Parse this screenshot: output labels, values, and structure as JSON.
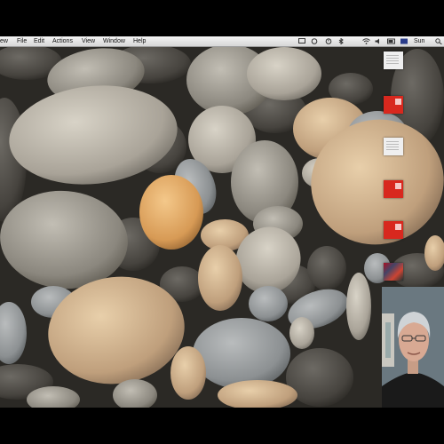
{
  "menubar": {
    "app_menu_partial": "ew",
    "items": [
      "File",
      "Edit",
      "Actions",
      "View",
      "Window",
      "Help"
    ],
    "right_label": "Sun"
  },
  "desktop": {
    "background": "river-stones-wallpaper",
    "icons": [
      "document-icon",
      "red-app-icon",
      "document-icon",
      "red-app-icon",
      "red-app-icon",
      "image-thumbnail-icon"
    ]
  },
  "overlay": {
    "type": "webcam-picture-in-picture"
  }
}
